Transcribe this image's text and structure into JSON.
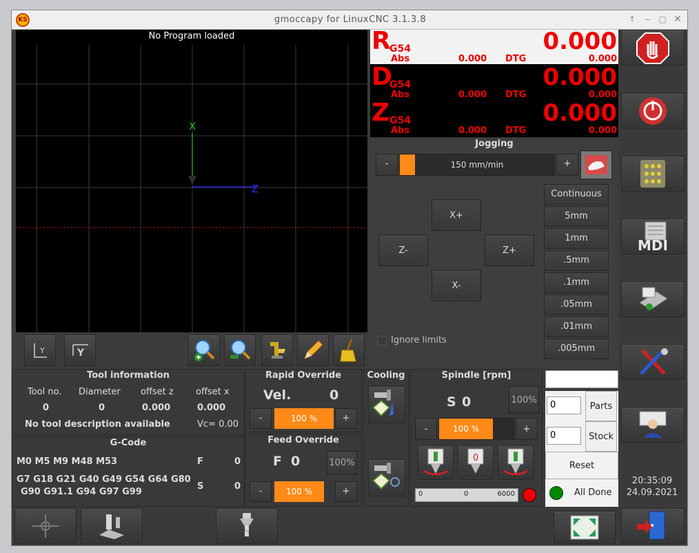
{
  "window": {
    "title": "gmoccapy for LinuxCNC  3.1.3.8",
    "logo_text": "KS"
  },
  "preview": {
    "status": "No Program loaded",
    "axis_x": "X",
    "axis_z": "Z"
  },
  "dro": [
    {
      "axis": "R",
      "coord": "G54",
      "value": "0.000",
      "abs_label": "Abs",
      "abs_value": "0.000",
      "dtg_label": "DTG",
      "dtg_value": "0.000"
    },
    {
      "axis": "D",
      "coord": "G54",
      "value": "0.000",
      "abs_label": "Abs",
      "abs_value": "0.000",
      "dtg_label": "DTG",
      "dtg_value": "0.000"
    },
    {
      "axis": "Z",
      "coord": "G54",
      "value": "0.000",
      "abs_label": "Abs",
      "abs_value": "0.000",
      "dtg_label": "DTG",
      "dtg_value": "0.000"
    }
  ],
  "jogging": {
    "title": "Jogging",
    "minus": "-",
    "plus": "+",
    "speed": "150 mm/min",
    "speed_fraction": 0.05,
    "buttons": {
      "xplus": "X+",
      "zminus": "Z-",
      "zplus": "Z+",
      "xminus": "X-"
    },
    "increments": [
      "Continuous",
      "5mm",
      "1mm",
      ".5mm",
      ".1mm",
      ".05mm",
      ".01mm",
      ".005mm"
    ],
    "ignore_limits": "Ignore limits"
  },
  "tool_info": {
    "title": "Tool information",
    "headers": [
      "Tool no.",
      "Diameter",
      "offset z",
      "offset x"
    ],
    "values": [
      "0",
      "0",
      "0.000",
      "0.000"
    ],
    "description": "No tool description available",
    "vc": "Vc= 0.00"
  },
  "gcode": {
    "title": "G-Code",
    "mcodes": "M0 M5 M9 M48 M53",
    "f_label": "F",
    "f_value": "0",
    "gcodes_line1": "G7 G18 G21 G40 G49 G54 G64 G80",
    "gcodes_line2": "G90 G91.1 G94 G97 G99",
    "s_label": "S",
    "s_value": "0"
  },
  "rapid": {
    "title": "Rapid Override",
    "vel_label": "Vel.",
    "vel_value": "0",
    "minus": "-",
    "plus": "+",
    "percent": "100 %"
  },
  "feed": {
    "title": "Feed Override",
    "f_label": "F",
    "f_value": "0",
    "box": "100%",
    "minus": "-",
    "plus": "+",
    "percent": "100 %"
  },
  "cooling": {
    "title": "Cooling"
  },
  "spindle": {
    "title": "Spindle [rpm]",
    "s_label": "S",
    "s_value": "0",
    "box": "100%",
    "minus": "-",
    "plus": "+",
    "percent": "100 %",
    "bar_min": "0",
    "bar_cur": "0",
    "bar_max": "6000"
  },
  "counters": {
    "parts_value": "0",
    "parts_label": "Parts",
    "stock_value": "0",
    "stock_label": "Stock",
    "reset": "Reset",
    "status": "All Done"
  },
  "clock": {
    "time": "20:35:09",
    "date": "24.09.2021"
  },
  "side": {
    "mdi": "MDI"
  },
  "colors": {
    "accent": "#ff8a18",
    "dro_red": "#ee0000",
    "green_led": "#008800",
    "red_led": "#ee0000"
  }
}
